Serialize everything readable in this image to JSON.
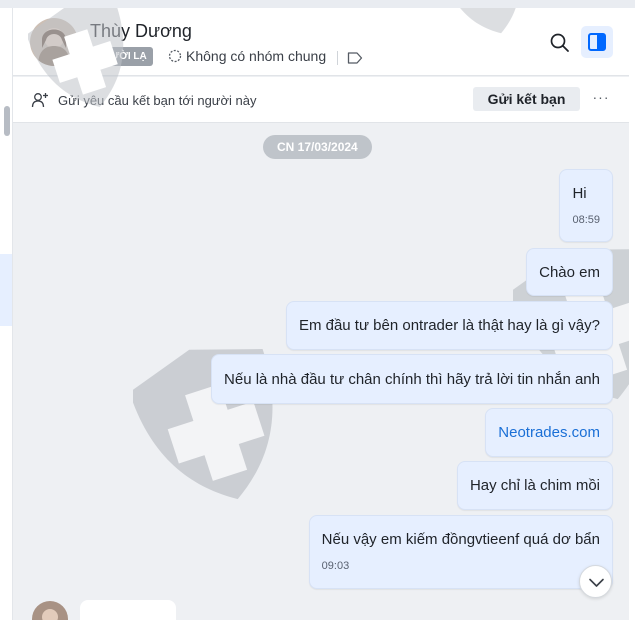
{
  "contact": {
    "name": "Thùy Dương",
    "badge": "NGƯỜI LẠ",
    "group_status": "Không có nhóm chung"
  },
  "friend_request": {
    "text": "Gửi yêu cầu kết bạn tới người này",
    "button_label": "Gửi kết bạn",
    "more_label": "···"
  },
  "date_separator": "CN 17/03/2024",
  "messages": [
    {
      "text": "Hi",
      "time": "08:59"
    },
    {
      "text": "Chào em",
      "time": ""
    },
    {
      "text": "Em đầu tư bên ontrader là thật hay là gì vậy?",
      "time": ""
    },
    {
      "text": "Nếu là nhà đầu tư chân chính thì hãy trả lời tin nhắn anh",
      "time": ""
    },
    {
      "text": "Neotrades.com",
      "time": "",
      "is_link": true
    },
    {
      "text": "Hay chỉ là chim mồi",
      "time": ""
    },
    {
      "text": "Nếu vậy em kiếm đồngvtieenf quá dơ bẩn",
      "time": "09:03"
    }
  ],
  "icons": {
    "header": [
      "avatar",
      "search-icon",
      "side-panel-icon",
      "group-icon",
      "tag-icon"
    ],
    "friendbar": [
      "add-user-icon"
    ],
    "chat": [
      "chevron-down-icon",
      "shield-watermark-icon"
    ]
  },
  "colors": {
    "sent_bubble": "#e6efff",
    "link": "#1a6fd6",
    "chat_background": "#eef0f3",
    "badge": "#9aa0a8",
    "accent": "#0068ff"
  }
}
